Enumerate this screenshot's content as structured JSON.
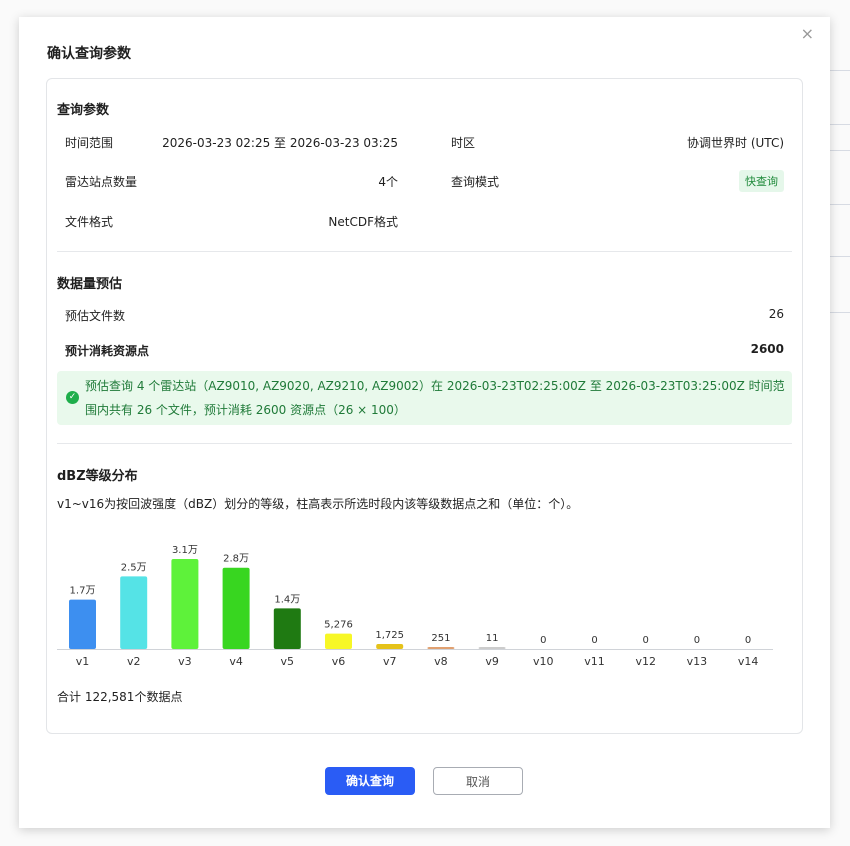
{
  "modal": {
    "title": "确认查询参数",
    "close_label": "×"
  },
  "query_params": {
    "title": "查询参数",
    "time_range_label": "时间范围",
    "time_range_value": "2026-03-23 02:25 至 2026-03-23 03:25",
    "timezone_label": "时区",
    "timezone_value": "协调世界时 (UTC)",
    "station_count_label": "雷达站点数量",
    "station_count_value": "4个",
    "query_mode_label": "查询模式",
    "query_mode_value": "快查询",
    "file_format_label": "文件格式",
    "file_format_value": "NetCDF格式"
  },
  "estimate": {
    "title": "数据量预估",
    "file_count_label": "预估文件数",
    "file_count_value": "26",
    "cost_label": "预计消耗资源点",
    "cost_value": "2600",
    "alert_text": "预估查询 4 个雷达站（AZ9010, AZ9020, AZ9210, AZ9002）在 2026-03-23T02:25:00Z 至 2026-03-23T03:25:00Z 时间范围内共有 26 个文件，预计消耗 2600 资源点（26 × 100）"
  },
  "dbz": {
    "title": "dBZ等级分布",
    "description": "v1~v16为按回波强度（dBZ）划分的等级，柱高表示所选时段内该等级数据点之和（单位：个）。",
    "total_text": "合计 122,581个数据点"
  },
  "chart_data": {
    "type": "bar",
    "categories": [
      "v1",
      "v2",
      "v3",
      "v4",
      "v5",
      "v6",
      "v7",
      "v8",
      "v9",
      "v10",
      "v11",
      "v12",
      "v13",
      "v14"
    ],
    "values": [
      17000,
      25000,
      31000,
      28000,
      14000,
      5276,
      1725,
      251,
      11,
      0,
      0,
      0,
      0,
      0
    ],
    "data_labels": [
      "1.7万",
      "2.5万",
      "3.1万",
      "2.8万",
      "1.4万",
      "5,276",
      "1,725",
      "251",
      "11",
      "0",
      "0",
      "0",
      "0",
      "0"
    ],
    "colors": [
      "#3d8ff0",
      "#55e3e6",
      "#5ef23a",
      "#38d620",
      "#1f7a12",
      "#f7f726",
      "#e5c21a",
      "#e0a070",
      "#cccccc",
      "#cccccc",
      "#cccccc",
      "#cccccc",
      "#cccccc",
      "#cccccc"
    ],
    "ylim": [
      0,
      31000
    ],
    "grid": false
  },
  "buttons": {
    "confirm": "确认查询",
    "cancel": "取消"
  }
}
